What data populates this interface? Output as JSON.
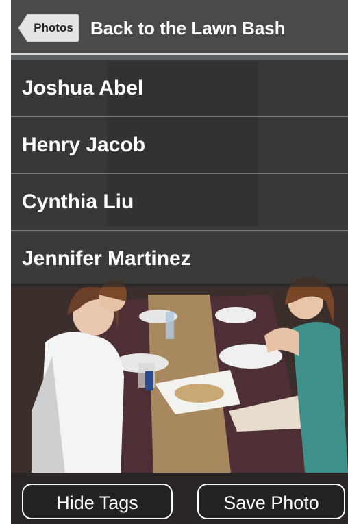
{
  "header": {
    "back_label": "Photos",
    "title": "Back to the Lawn Bash"
  },
  "tags": [
    {
      "name": "Joshua Abel"
    },
    {
      "name": "Henry Jacob"
    },
    {
      "name": "Cynthia Liu"
    },
    {
      "name": "Jennifer Martinez"
    }
  ],
  "footer": {
    "hide_tags_label": "Hide Tags",
    "save_photo_label": "Save Photo"
  },
  "colors": {
    "header_bg": "#4a4a4a",
    "tag_overlay": "#282828",
    "tablecloth": "#4e2f36",
    "burlap": "#a8895f"
  }
}
